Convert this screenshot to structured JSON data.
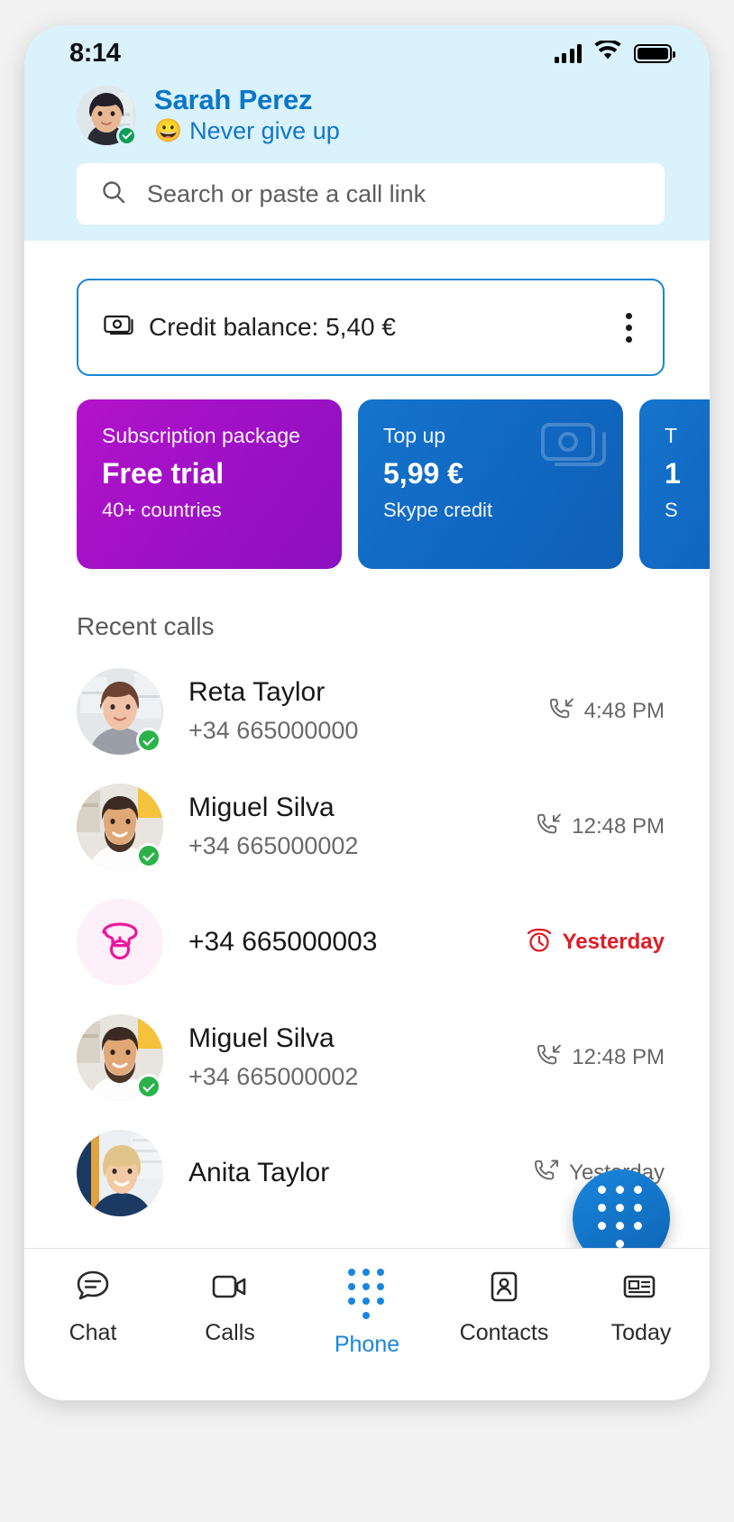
{
  "statusbar": {
    "time": "8:14",
    "signal_icon": "cellular-signal-icon",
    "wifi_icon": "wifi-icon",
    "battery_icon": "battery-full-icon"
  },
  "profile": {
    "name": "Sarah Perez",
    "mood_emoji": "😀",
    "mood": "Never give up",
    "presence": "online"
  },
  "search": {
    "placeholder": "Search or paste a call link",
    "value": "",
    "icon": "search-icon"
  },
  "credit": {
    "label": "Credit balance: 5,40 €",
    "icon": "banknote-icon",
    "menu_icon": "more-vertical-icon"
  },
  "promo_cards": [
    {
      "kicker": "Subscription package",
      "title": "Free trial",
      "sub": "40+ countries",
      "color": "#a411c6"
    },
    {
      "kicker": "Top up",
      "title": "5,99 €",
      "sub": "Skype credit",
      "color": "#1168c2",
      "icon": "banknote-icon"
    },
    {
      "kicker": "T",
      "title": "1",
      "sub": "S",
      "color": "#1168c2"
    }
  ],
  "recent": {
    "title": "Recent calls",
    "calls": [
      {
        "name": "Reta Taylor",
        "number": "+34 665000000",
        "time": "4:48 PM",
        "direction": "incoming",
        "icon": "call-incoming-icon",
        "presence": "online",
        "avatar": "photo-woman-1"
      },
      {
        "name": "Miguel Silva",
        "number": "+34 665000002",
        "time": "12:48 PM",
        "direction": "incoming",
        "icon": "call-incoming-icon",
        "presence": "online",
        "avatar": "photo-man-1"
      },
      {
        "name": "+34 665000003",
        "number": "",
        "time": "Yesterday",
        "direction": "missed",
        "icon": "call-missed-icon",
        "presence": "none",
        "avatar": "phone-pink-icon"
      },
      {
        "name": "Miguel Silva",
        "number": "+34 665000002",
        "time": "12:48 PM",
        "direction": "incoming",
        "icon": "call-incoming-icon",
        "presence": "online",
        "avatar": "photo-man-1"
      },
      {
        "name": "Anita Taylor",
        "number": "",
        "time": "Yesterday",
        "direction": "outgoing",
        "icon": "call-outgoing-icon",
        "presence": "none",
        "avatar": "photo-woman-2"
      }
    ]
  },
  "fab": {
    "icon": "dialpad-icon",
    "label": "Dialpad"
  },
  "tabs": [
    {
      "label": "Chat",
      "icon": "chat-bubble-icon",
      "active": false
    },
    {
      "label": "Calls",
      "icon": "video-camera-icon",
      "active": false
    },
    {
      "label": "Phone",
      "icon": "dialpad-icon",
      "active": true
    },
    {
      "label": "Contacts",
      "icon": "contact-card-icon",
      "active": false
    },
    {
      "label": "Today",
      "icon": "newspaper-icon",
      "active": false
    }
  ],
  "colors": {
    "accent": "#1a86dd",
    "brand_blue": "#0b76c9",
    "header_bg": "#d9f2fb",
    "missed_red": "#e01b24",
    "purple": "#a411c6"
  }
}
